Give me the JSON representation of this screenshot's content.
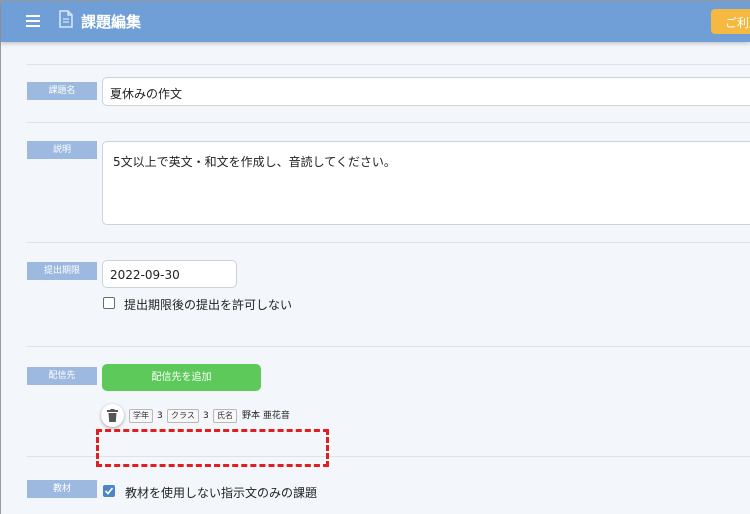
{
  "header": {
    "title": "課題編集",
    "usage_button": "ご利用"
  },
  "fields": {
    "name": {
      "label": "課題名",
      "value": "夏休みの作文"
    },
    "description": {
      "label": "説明",
      "value": "5文以上で英文・和文を作成し、音読してください。"
    },
    "deadline": {
      "label": "提出期限",
      "value": "2022-09-30",
      "late_checkbox_label": "提出期限後の提出を許可しない",
      "late_checked": false
    },
    "delivery": {
      "label": "配信先",
      "add_button": "配信先を追加",
      "recipient": {
        "grade_tag": "学年",
        "grade": "3",
        "class_tag": "クラス",
        "class": "3",
        "name_tag": "氏名",
        "name": "野本 亜花音"
      }
    },
    "material": {
      "label": "教材",
      "checkbox_label": "教材を使用しない指示文のみの課題",
      "checked": true
    }
  },
  "colors": {
    "header": "#6f9fd6",
    "label_bg": "#9db9e0",
    "add_button": "#5cc95a",
    "usage_button": "#f5b841",
    "highlight": "#e02020"
  },
  "icons": [
    "menu-icon",
    "document-icon",
    "trash-icon",
    "check-icon"
  ]
}
